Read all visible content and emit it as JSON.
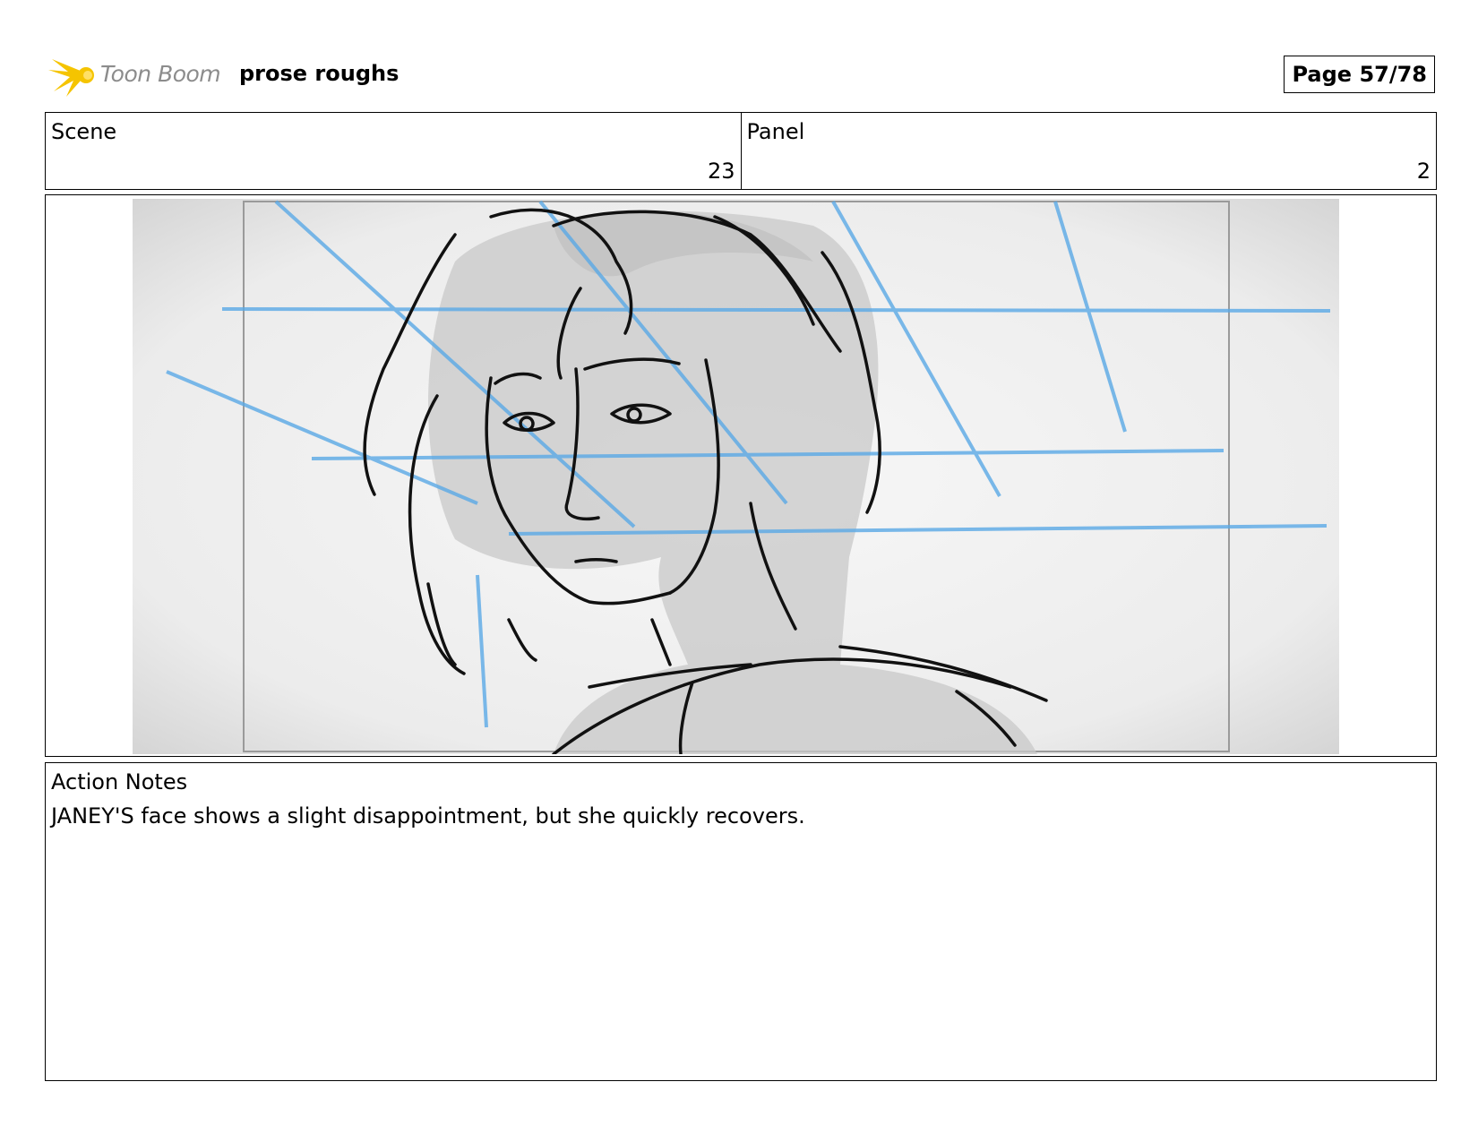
{
  "header": {
    "logo_text": "Toon Boom",
    "project_title": "prose roughs",
    "page_label": "Page 57/78"
  },
  "info": {
    "scene_label": "Scene",
    "scene_value": "23",
    "panel_label": "Panel",
    "panel_value": "2"
  },
  "notes": {
    "label": "Action Notes",
    "text": "JANEY'S face shows a slight disappointment, but she quickly recovers."
  },
  "colors": {
    "guide_blue": "#5aa9e6",
    "sketch_gray": "#c8c8c8",
    "logo_yellow": "#f5c400"
  }
}
